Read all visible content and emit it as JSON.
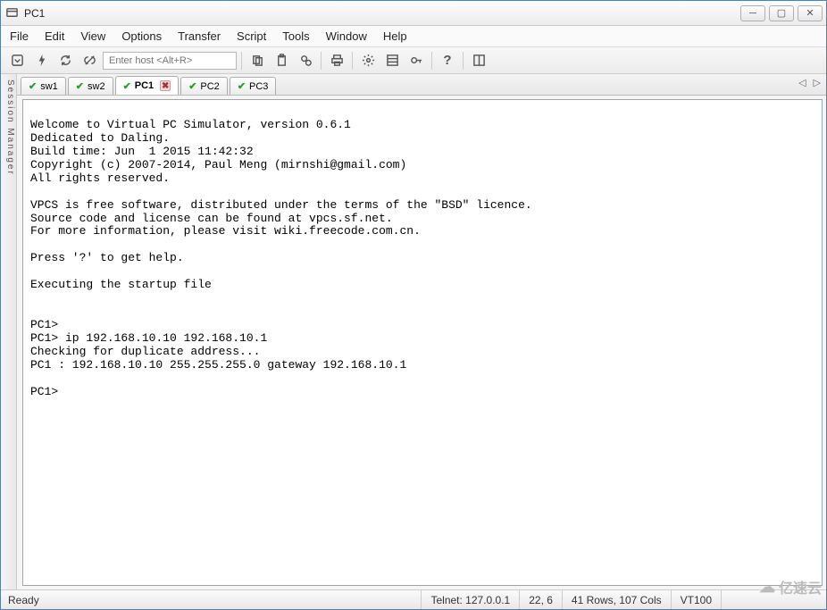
{
  "window": {
    "title": "PC1"
  },
  "menu": {
    "file": "File",
    "edit": "Edit",
    "view": "View",
    "options": "Options",
    "transfer": "Transfer",
    "script": "Script",
    "tools": "Tools",
    "window": "Window",
    "help": "Help"
  },
  "toolbar": {
    "host_placeholder": "Enter host <Alt+R>"
  },
  "session_manager_label": "Session Manager",
  "tabs": [
    {
      "label": "sw1",
      "active": false,
      "closeable": false
    },
    {
      "label": "sw2",
      "active": false,
      "closeable": false
    },
    {
      "label": "PC1",
      "active": true,
      "closeable": true
    },
    {
      "label": "PC2",
      "active": false,
      "closeable": false
    },
    {
      "label": "PC3",
      "active": false,
      "closeable": false
    }
  ],
  "terminal": {
    "text": "\nWelcome to Virtual PC Simulator, version 0.6.1\nDedicated to Daling.\nBuild time: Jun  1 2015 11:42:32\nCopyright (c) 2007-2014, Paul Meng (mirnshi@gmail.com)\nAll rights reserved.\n\nVPCS is free software, distributed under the terms of the \"BSD\" licence.\nSource code and license can be found at vpcs.sf.net.\nFor more information, please visit wiki.freecode.com.cn.\n\nPress '?' to get help.\n\nExecuting the startup file\n\n\nPC1>\nPC1> ip 192.168.10.10 192.168.10.1\nChecking for duplicate address...\nPC1 : 192.168.10.10 255.255.255.0 gateway 192.168.10.1\n\nPC1>"
  },
  "status": {
    "ready": "Ready",
    "conn": "Telnet: 127.0.0.1",
    "cursor": "22,   6",
    "dims": "41 Rows, 107 Cols",
    "emu": "VT100"
  },
  "watermark": "亿速云"
}
